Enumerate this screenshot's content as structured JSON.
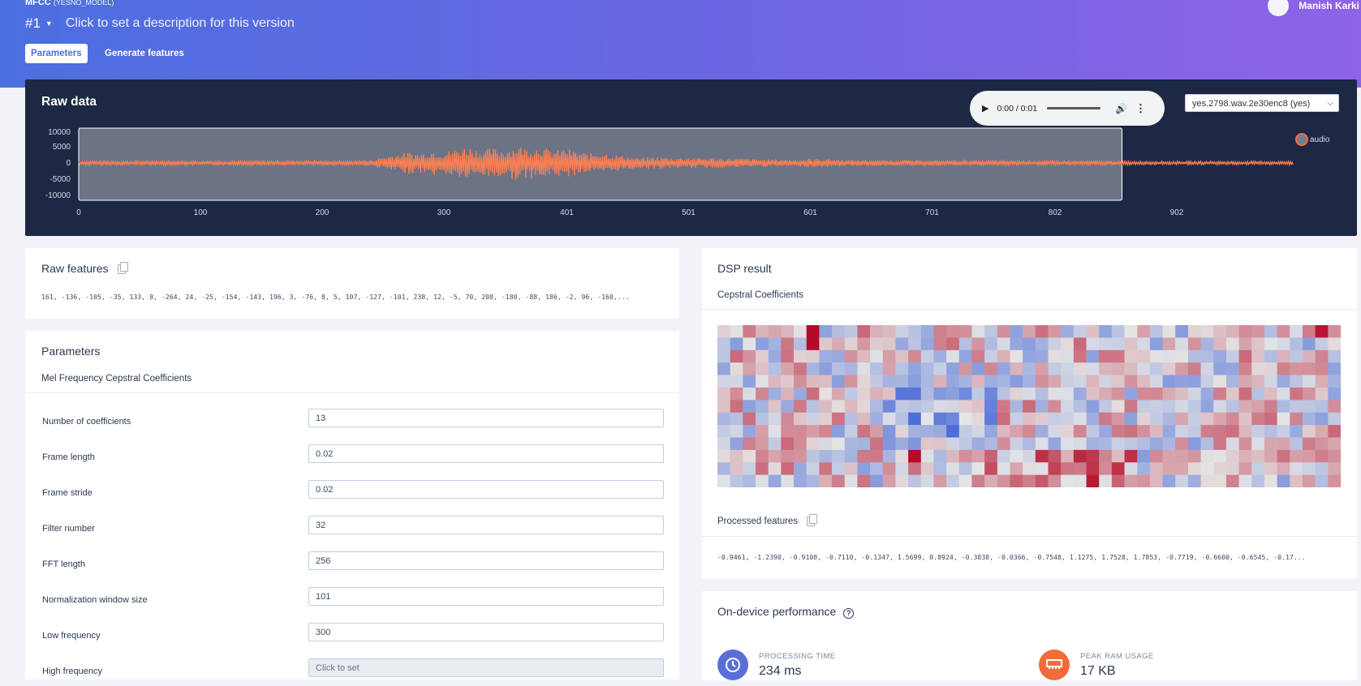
{
  "header": {
    "project_name": "MFCC",
    "project_id": "(YESNO_MODEL)",
    "version": "#1",
    "version_description_placeholder": "Click to set a description for this version",
    "user_name": "Manish Karki",
    "tabs": [
      {
        "label": "Parameters",
        "active": true
      },
      {
        "label": "Generate features",
        "active": false
      }
    ]
  },
  "raw_data": {
    "title": "Raw data",
    "audio_player": {
      "time": "0:00 / 0:01"
    },
    "sample_select": "yes.2798.wav.2e30enc8 (yes)",
    "chart_data": {
      "type": "line",
      "series": [
        {
          "name": "audio",
          "color": "#ff7f50"
        }
      ],
      "y_ticks": [
        "10000",
        "5000",
        "0",
        "-5000",
        "-10000"
      ],
      "x_ticks": [
        "0",
        "100",
        "200",
        "300",
        "401",
        "501",
        "601",
        "701",
        "802",
        "902"
      ],
      "ylim": [
        -12000,
        12000
      ],
      "xlim": [
        0,
        1000
      ],
      "highlight_window": [
        0,
        857
      ],
      "envelope": [
        [
          0,
          600
        ],
        [
          20,
          700
        ],
        [
          40,
          600
        ],
        [
          60,
          700
        ],
        [
          80,
          800
        ],
        [
          100,
          600
        ],
        [
          120,
          700
        ],
        [
          140,
          600
        ],
        [
          160,
          700
        ],
        [
          180,
          650
        ],
        [
          200,
          700
        ],
        [
          220,
          700
        ],
        [
          240,
          900
        ],
        [
          250,
          2000
        ],
        [
          260,
          2800
        ],
        [
          270,
          3500
        ],
        [
          280,
          3000
        ],
        [
          290,
          4000
        ],
        [
          300,
          3500
        ],
        [
          310,
          4500
        ],
        [
          320,
          5200
        ],
        [
          330,
          4000
        ],
        [
          340,
          4800
        ],
        [
          350,
          4200
        ],
        [
          360,
          5500
        ],
        [
          370,
          4800
        ],
        [
          380,
          5200
        ],
        [
          390,
          3800
        ],
        [
          400,
          4600
        ],
        [
          410,
          3500
        ],
        [
          420,
          3000
        ],
        [
          430,
          3600
        ],
        [
          440,
          2600
        ],
        [
          450,
          2300
        ],
        [
          460,
          1600
        ],
        [
          470,
          1800
        ],
        [
          480,
          1900
        ],
        [
          490,
          1600
        ],
        [
          500,
          1800
        ],
        [
          510,
          1500
        ],
        [
          520,
          1700
        ],
        [
          530,
          1400
        ],
        [
          540,
          1500
        ],
        [
          550,
          1300
        ],
        [
          560,
          1200
        ],
        [
          570,
          1100
        ],
        [
          580,
          1200
        ],
        [
          590,
          1000
        ],
        [
          600,
          1300
        ],
        [
          610,
          1400
        ],
        [
          620,
          1200
        ],
        [
          630,
          1000
        ],
        [
          640,
          900
        ],
        [
          650,
          1000
        ],
        [
          660,
          850
        ],
        [
          680,
          900
        ],
        [
          700,
          800
        ],
        [
          720,
          800
        ],
        [
          740,
          700
        ],
        [
          760,
          700
        ],
        [
          780,
          650
        ],
        [
          800,
          650
        ],
        [
          820,
          600
        ],
        [
          840,
          600
        ],
        [
          860,
          600
        ],
        [
          880,
          550
        ],
        [
          900,
          550
        ],
        [
          920,
          550
        ],
        [
          940,
          550
        ],
        [
          960,
          550
        ],
        [
          980,
          550
        ],
        [
          998,
          550
        ]
      ]
    }
  },
  "raw_features": {
    "title": "Raw features",
    "values": "161, -136, -105, -35, 133, 8, -264, 24, -25, -154, -143, 196, 3, -76, 8, 5, 107, -127, -101, 238, 12, -5, 70, 208, -180, -88, 186, -2, 96, -160,..."
  },
  "parameters": {
    "title": "Parameters",
    "subtitle": "Mel Frequency Cepstral Coefficients",
    "fields": [
      {
        "label": "Number of coefficients",
        "value": "13"
      },
      {
        "label": "Frame length",
        "value": "0.02"
      },
      {
        "label": "Frame stride",
        "value": "0.02"
      },
      {
        "label": "Filter number",
        "value": "32"
      },
      {
        "label": "FFT length",
        "value": "256"
      },
      {
        "label": "Normalization window size",
        "value": "101"
      },
      {
        "label": "Low frequency",
        "value": "300"
      },
      {
        "label": "High frequency",
        "value": "Click to set",
        "disabled": true
      }
    ]
  },
  "dsp_result": {
    "title": "DSP result",
    "subtitle": "Cepstral Coefficients",
    "heatmap": {
      "rows": 13,
      "cols": 49,
      "low_color": "#3a5fd6",
      "mid_color": "#e5e5e5",
      "high_color": "#b2001e"
    },
    "processed_title": "Processed features",
    "processed_values": "-0.9461, -1.2390, -0.9108, -0.7110, -0.1347, 1.5699, 0.8924, -0.3838, -0.0366, -0.7548, 1.1275, 1.7528, 1.7853, -0.7719, -0.6600, -0.6545, -0.17..."
  },
  "performance": {
    "title": "On-device performance",
    "processing_time": {
      "label": "PROCESSING TIME",
      "value": "234 ms",
      "color": "#5a6fd6"
    },
    "peak_ram": {
      "label": "PEAK RAM USAGE",
      "value": "17 KB",
      "color": "#f26b3a"
    }
  }
}
